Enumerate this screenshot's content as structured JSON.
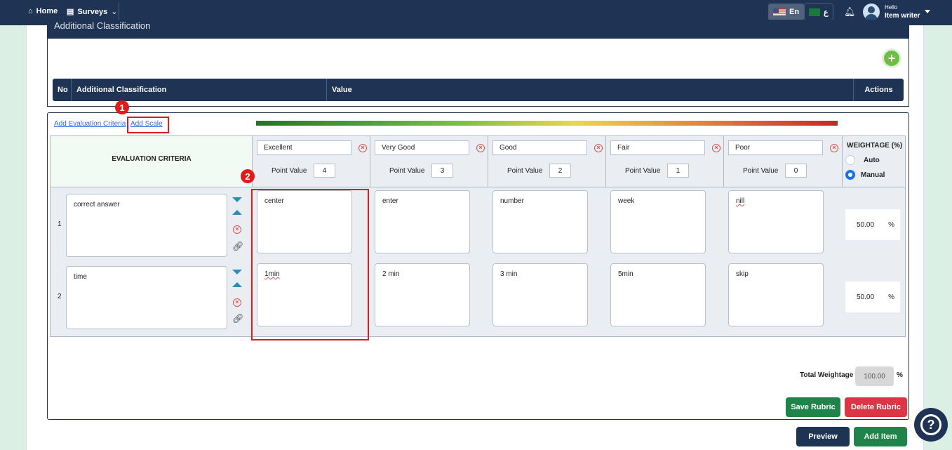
{
  "nav": {
    "home": "Home",
    "surveys": "Surveys",
    "lang_en": "En",
    "lang_ar": "ع",
    "greeting": "Hello",
    "user_role": "Item writer"
  },
  "additional": {
    "title": "Additional Classification",
    "columns": [
      "No",
      "Additional Classification",
      "Value",
      "Actions"
    ]
  },
  "rubric": {
    "add_criteria": "Add Evaluation Criteria",
    "add_scale": "Add Scale",
    "criteria_header": "EVALUATION CRITERIA",
    "point_value_label": "Point Value",
    "scales": [
      {
        "name": "Excellent",
        "points": "4"
      },
      {
        "name": "Very Good",
        "points": "3"
      },
      {
        "name": "Good",
        "points": "2"
      },
      {
        "name": "Fair",
        "points": "1"
      },
      {
        "name": "Poor",
        "points": "0"
      }
    ],
    "weightage_header": "WEIGHTAGE (%)",
    "auto_label": "Auto",
    "manual_label": "Manual",
    "rows": [
      {
        "no": "1",
        "criterion": "correct answer",
        "cells": [
          "center",
          "enter",
          "number",
          "week",
          "nill"
        ],
        "weight": "50.00"
      },
      {
        "no": "2",
        "criterion": "time",
        "cells": [
          "1min",
          "2 min",
          "3 min",
          "5min",
          "skip"
        ],
        "weight": "50.00"
      }
    ],
    "percent": "%",
    "total_label": "Total Weightage",
    "total_value": "100.00",
    "save_btn": "Save Rubric",
    "delete_btn": "Delete Rubric"
  },
  "footer": {
    "preview_btn": "Preview",
    "add_item_btn": "Add Item"
  },
  "annotations": {
    "badge1": "1",
    "badge2": "2"
  },
  "colors": {
    "navy": "#1f3454",
    "green": "#1e8449",
    "red": "#dc3545",
    "highlight": "#e01b1b"
  }
}
